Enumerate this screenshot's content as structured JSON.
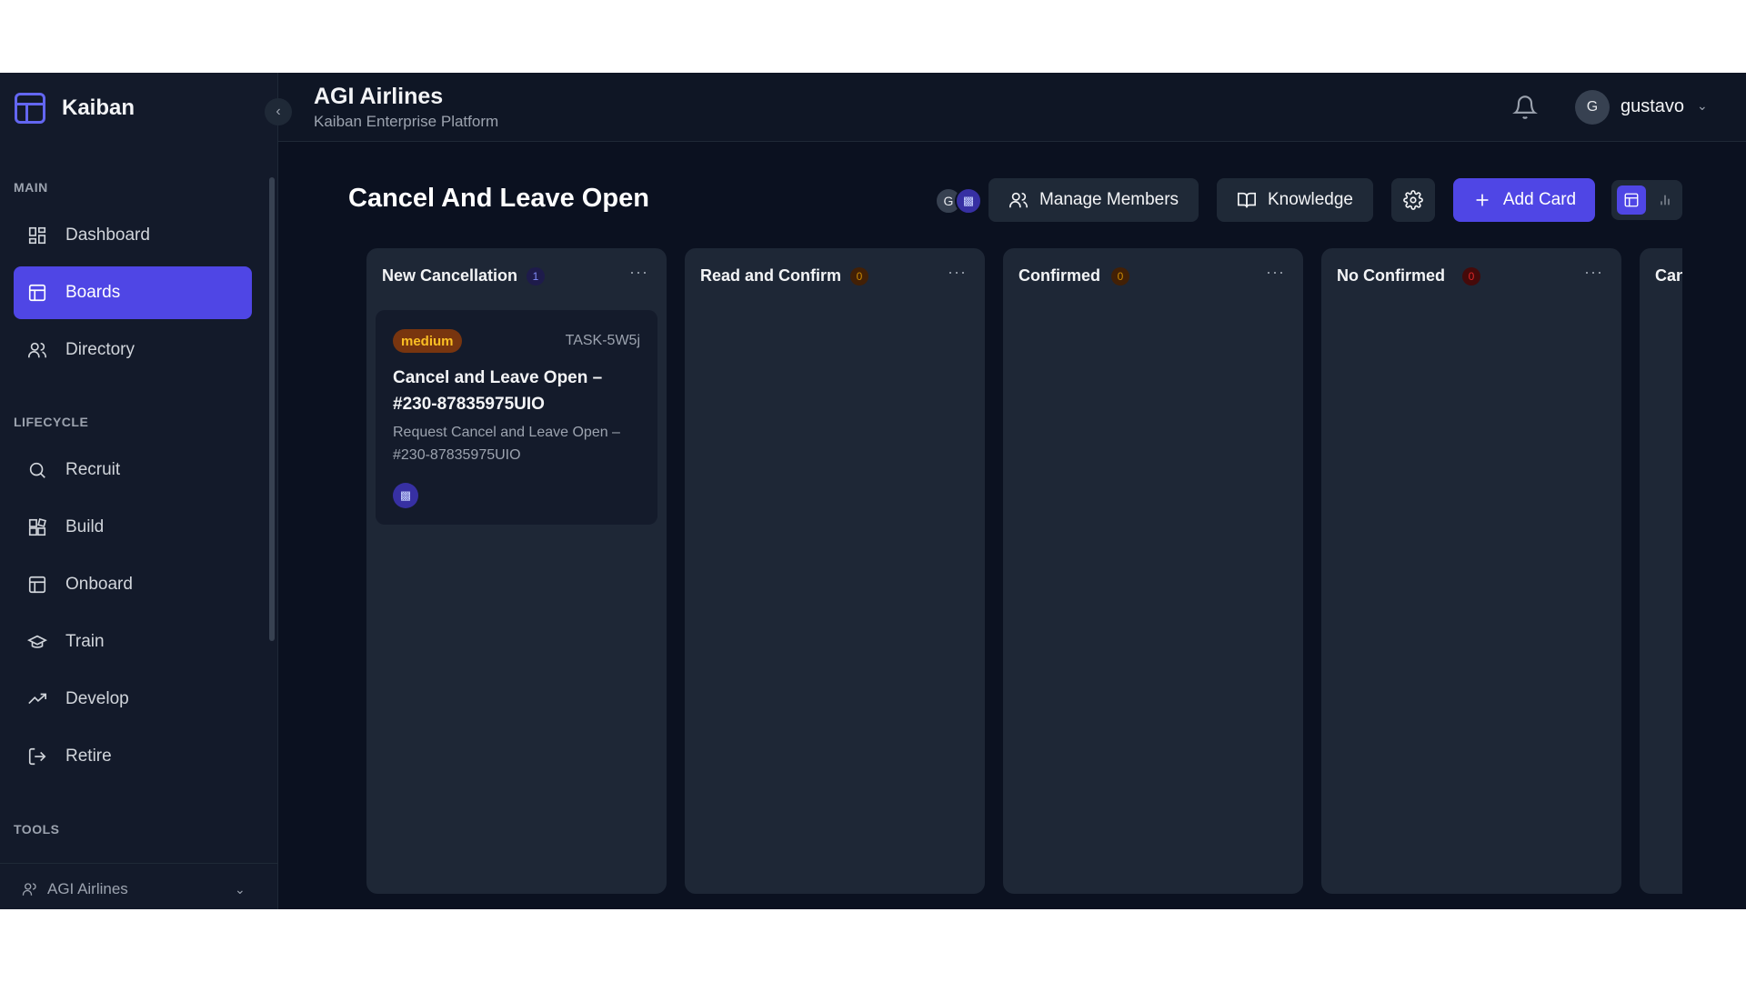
{
  "app": {
    "name": "Kaiban"
  },
  "header": {
    "org_title": "AGI Airlines",
    "org_subtitle": "Kaiban Enterprise Platform",
    "user": {
      "initial": "G",
      "name": "gustavo"
    }
  },
  "sidebar": {
    "sections": [
      {
        "label": "MAIN",
        "items": [
          {
            "label": "Dashboard",
            "icon": "dashboard-icon"
          },
          {
            "label": "Boards",
            "icon": "board-icon",
            "active": true
          },
          {
            "label": "Directory",
            "icon": "users-icon"
          }
        ]
      },
      {
        "label": "LIFECYCLE",
        "items": [
          {
            "label": "Recruit",
            "icon": "search-icon"
          },
          {
            "label": "Build",
            "icon": "blocks-icon"
          },
          {
            "label": "Onboard",
            "icon": "layout-icon"
          },
          {
            "label": "Train",
            "icon": "graduation-cap-icon"
          },
          {
            "label": "Develop",
            "icon": "trending-up-icon"
          },
          {
            "label": "Retire",
            "icon": "logout-icon"
          }
        ]
      },
      {
        "label": "TOOLS",
        "items": []
      }
    ],
    "org_switcher": "AGI Airlines"
  },
  "board": {
    "title": "Cancel And Leave Open",
    "members": [
      {
        "initial": "G"
      },
      {
        "icon": "bot-icon"
      }
    ],
    "buttons": {
      "manage_members": "Manage Members",
      "knowledge": "Knowledge",
      "add_card": "Add Card"
    },
    "columns": [
      {
        "title": "New Cancellation",
        "count": "1",
        "count_color": "#6366f1",
        "cards": [
          {
            "priority": "medium",
            "id": "TASK-5W5j",
            "title": "Cancel and Leave Open – #230-87835975UIO",
            "description": "Request Cancel and Leave Open – #230-87835975UIO",
            "assignee_icon": "bot-icon"
          }
        ]
      },
      {
        "title": "Read and Confirm",
        "count": "0",
        "count_color": "#ca8a04",
        "cards": []
      },
      {
        "title": "Confirmed",
        "count": "0",
        "count_color": "#ca8a04",
        "cards": []
      },
      {
        "title": "No Confirmed",
        "count": "0",
        "count_color": "#dc2626",
        "cards": []
      },
      {
        "title": "Can",
        "count": "",
        "count_color": "",
        "cards": []
      }
    ]
  },
  "colors": {
    "accent": "#4f46e5",
    "background": "#0b1120",
    "column": "#1e2736"
  }
}
